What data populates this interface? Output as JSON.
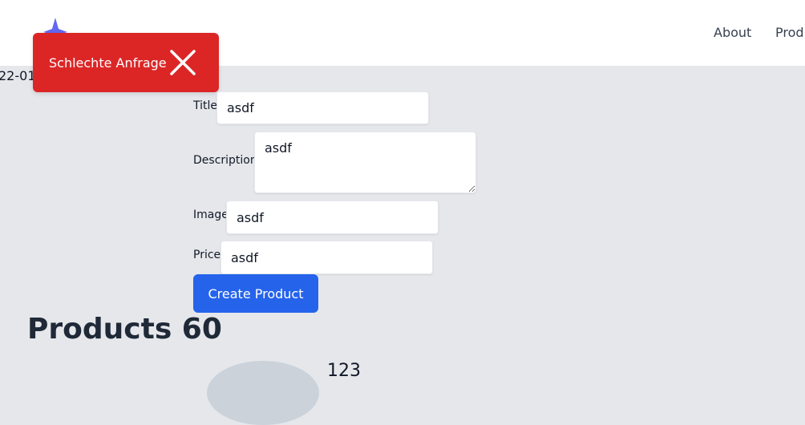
{
  "header": {
    "nav": [
      "About",
      "Prod"
    ]
  },
  "date_fragment": "22-01",
  "toast": {
    "message": "Schlechte Anfrage",
    "color": "#dc2626"
  },
  "form": {
    "title": {
      "label": "Title",
      "value": "asdf"
    },
    "description": {
      "label": "Description",
      "value": "asdf"
    },
    "image": {
      "label": "Image",
      "value": "asdf"
    },
    "price": {
      "label": "Price",
      "value": "asdf"
    },
    "submit_label": "Create Product",
    "accent": "#2563eb"
  },
  "products": {
    "heading": "Products 60",
    "items": [
      {
        "title": "123"
      }
    ]
  }
}
